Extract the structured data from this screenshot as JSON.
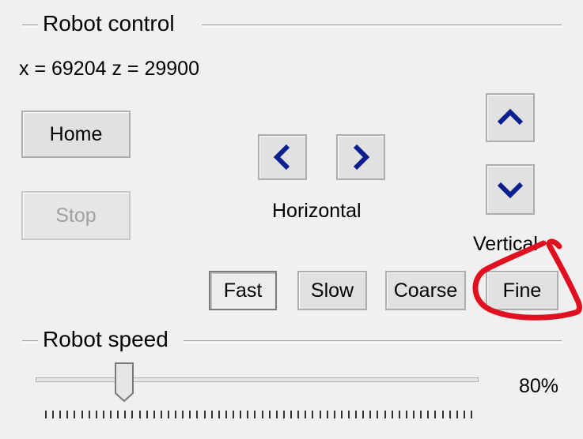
{
  "robot_control": {
    "title": "Robot control",
    "position_text": "x = 69204  z = 29900",
    "home_label": "Home",
    "stop_label": "Stop",
    "horizontal_label": "Horizontal",
    "vertical_label": "Vertical",
    "step_buttons": {
      "fast": "Fast",
      "slow": "Slow",
      "coarse": "Coarse",
      "fine": "Fine"
    }
  },
  "robot_speed": {
    "title": "Robot speed",
    "value_text": "80%",
    "level_fraction": 0.2
  },
  "colors": {
    "arrow": "#0b1f8f",
    "annotation": "#e01020"
  }
}
